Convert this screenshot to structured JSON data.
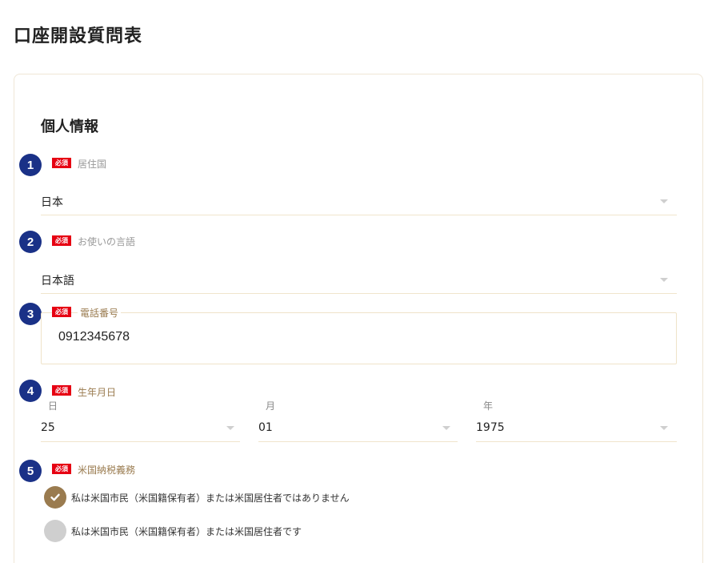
{
  "page_title": "口座開設質問表",
  "section_title": "個人情報",
  "required_badge": "必須",
  "fields": {
    "residence": {
      "step": "1",
      "label": "居住国",
      "value": "日本"
    },
    "language": {
      "step": "2",
      "label": "お使いの言語",
      "value": "日本語"
    },
    "phone": {
      "step": "3",
      "label": "電話番号",
      "value": "0912345678"
    },
    "birthdate": {
      "step": "4",
      "label": "生年月日",
      "day": {
        "label": "日",
        "value": "25"
      },
      "month": {
        "label": "月",
        "value": "01"
      },
      "year": {
        "label": "年",
        "value": "1975"
      }
    },
    "us_tax": {
      "step": "5",
      "label": "米国納税義務",
      "options": [
        {
          "text": "私は米国市民（米国籍保有者）または米国居住者ではありません",
          "selected": true
        },
        {
          "text": "私は米国市民（米国籍保有者）または米国居住者です",
          "selected": false
        }
      ]
    }
  },
  "colors": {
    "step_badge": "#1a3187",
    "required_badge": "#e60012",
    "accent_gold": "#9a7b4f",
    "unchecked": "#cfcfcf"
  }
}
